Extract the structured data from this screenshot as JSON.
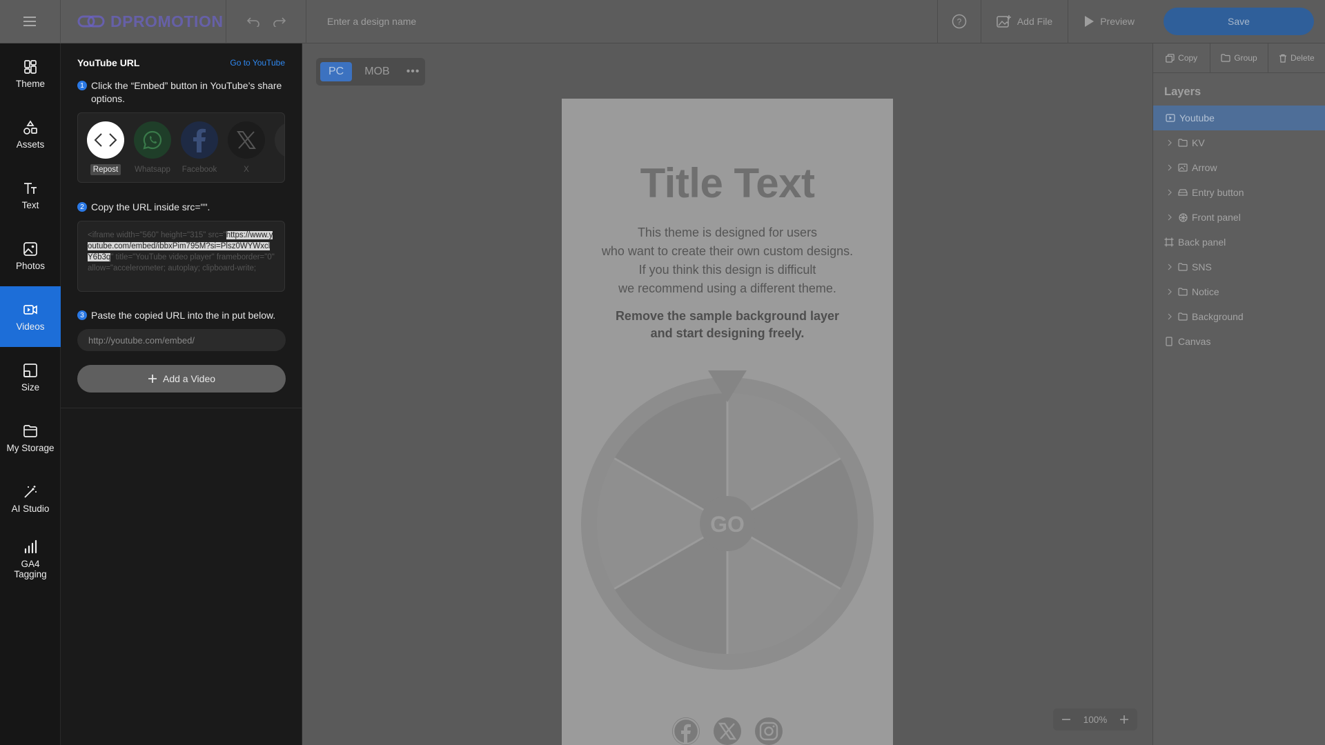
{
  "topbar": {
    "logo_text": "DPROMOTION",
    "design_name_placeholder": "Enter a design name",
    "add_file_label": "Add File",
    "preview_label": "Preview",
    "save_label": "Save"
  },
  "nav": {
    "items": [
      {
        "label": "Theme",
        "icon": "theme-icon"
      },
      {
        "label": "Assets",
        "icon": "assets-icon"
      },
      {
        "label": "Text",
        "icon": "text-icon"
      },
      {
        "label": "Photos",
        "icon": "photos-icon"
      },
      {
        "label": "Videos",
        "icon": "videos-icon",
        "active": true
      },
      {
        "label": "Size",
        "icon": "size-icon"
      },
      {
        "label": "My Storage",
        "icon": "storage-icon"
      },
      {
        "label": "AI Studio",
        "icon": "magic-wand-icon"
      },
      {
        "label": "GA4 Tagging",
        "icon": "bar-chart-icon"
      }
    ]
  },
  "video_panel": {
    "title": "YouTube URL",
    "go_link": "Go to YouTube",
    "step1": {
      "num": "1",
      "text": "Click the “Embed” button in YouTube’s share options."
    },
    "share_options": [
      {
        "label": "Repost",
        "icon": "embed-code-icon"
      },
      {
        "label": "Whatsapp",
        "icon": "whatsapp-icon"
      },
      {
        "label": "Facebook",
        "icon": "facebook-icon"
      },
      {
        "label": "X",
        "icon": "x-icon"
      }
    ],
    "step2": {
      "num": "2",
      "text": "Copy the URL inside src=\"\"."
    },
    "code": {
      "before": "<iframe width=\"560\" height=\"315\" src=\"",
      "url": "https://www.youtube.com/embed/ibbxPim795M?si=Plsz0WYWxclY6b3q",
      "after": "\" title=\"YouTube video player\" frameborder=\"0\" allow=\"accelerometer; autoplay; clipboard-write;"
    },
    "step3": {
      "num": "3",
      "text": "Paste the copied URL into the in put below."
    },
    "url_placeholder": "http://youtube.com/embed/",
    "add_button": "Add a Video"
  },
  "canvas": {
    "device_pc": "PC",
    "device_mob": "MOB",
    "title": "Title Text",
    "body_lines": [
      "This theme is designed for users",
      "who want to create their own custom designs.",
      "If you think this design is difficult",
      "we recommend using a different theme."
    ],
    "bold_lines": [
      "Remove the sample background layer",
      "and start designing freely."
    ],
    "go_label": "GO",
    "zoom": "100%"
  },
  "layers_panel": {
    "copy_label": "Copy",
    "group_label": "Group",
    "delete_label": "Delete",
    "title": "Layers",
    "items": [
      {
        "label": "Youtube",
        "icon": "video-icon",
        "selected": true,
        "expandable": false
      },
      {
        "label": "KV",
        "icon": "folder-icon",
        "expandable": true
      },
      {
        "label": "Arrow",
        "icon": "image-icon",
        "expandable": true
      },
      {
        "label": "Entry button",
        "icon": "button-icon",
        "expandable": true
      },
      {
        "label": "Front panel",
        "icon": "component-icon",
        "expandable": true
      },
      {
        "label": "Back panel",
        "icon": "frame-icon",
        "expandable": false
      },
      {
        "label": "SNS",
        "icon": "folder-icon",
        "expandable": true
      },
      {
        "label": "Notice",
        "icon": "folder-icon",
        "expandable": true
      },
      {
        "label": "Background",
        "icon": "folder-icon",
        "expandable": true
      },
      {
        "label": "Canvas",
        "icon": "canvas-icon",
        "expandable": false
      }
    ]
  },
  "colors": {
    "accent": "#1d6ed8",
    "link": "#2f88f0",
    "logo": "#6b62c8"
  }
}
